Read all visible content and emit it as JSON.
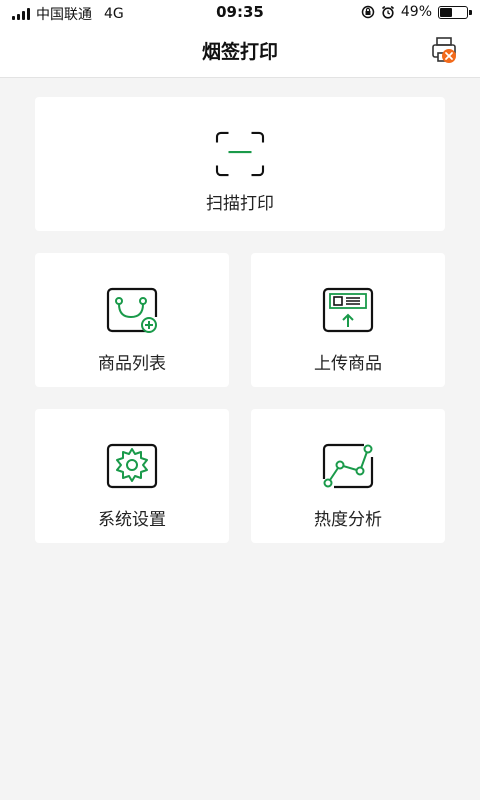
{
  "status_bar": {
    "carrier": "中国联通",
    "network": "4G",
    "time": "09:35",
    "battery_percent": "49%",
    "battery_level": 0.49
  },
  "header": {
    "title": "烟签打印",
    "printer_icon": "printer-disconnected-icon"
  },
  "menu": {
    "scan_print": {
      "label": "扫描打印",
      "icon": "scan-frame-icon"
    },
    "product_list": {
      "label": "商品列表",
      "icon": "product-list-icon"
    },
    "upload_product": {
      "label": "上传商品",
      "icon": "upload-product-icon"
    },
    "system_settings": {
      "label": "系统设置",
      "icon": "settings-gear-icon"
    },
    "heat_analysis": {
      "label": "热度分析",
      "icon": "trend-chart-icon"
    }
  },
  "colors": {
    "accent_green": "#1a9a4a",
    "warning_orange": "#f26a1b",
    "background": "#f4f4f4",
    "card": "#ffffff"
  }
}
